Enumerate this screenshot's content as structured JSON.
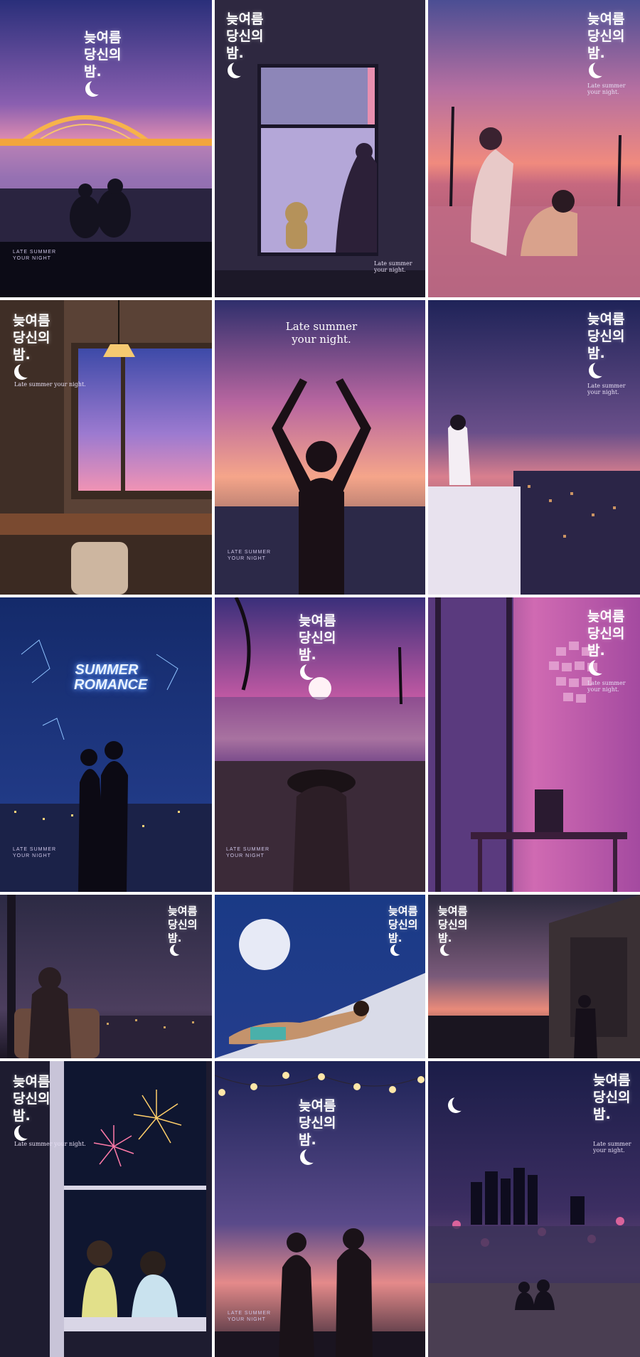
{
  "headline": {
    "line1": "늦여름",
    "line2": "당신의",
    "line3": "밤."
  },
  "subline": "Late summer your night.",
  "caption": {
    "line1": "LATE SUMMER",
    "line2": "YOUR NIGHT"
  },
  "serif_title": {
    "line1": "Late summer",
    "line2": "your night."
  },
  "neon_title": {
    "line1": "SUMMER",
    "line2": "ROMANCE"
  },
  "colors": {
    "night": "#1f2458",
    "dusk_pink": "#e77aa6",
    "violet": "#7c5fb8",
    "gold": "#f2b04a"
  },
  "tiles": [
    {
      "id": 1,
      "scene": "couple watching lit arch bridge over river at dusk"
    },
    {
      "id": 2,
      "scene": "woman sitting at window with teddy bear"
    },
    {
      "id": 3,
      "scene": "couple in infinity pool at sunset with palms"
    },
    {
      "id": 4,
      "scene": "room interior with pendant lamp and window"
    },
    {
      "id": 5,
      "scene": "silhouette with raised arms at sunset sea"
    },
    {
      "id": 6,
      "scene": "woman on rooftop overlooking city at dusk"
    },
    {
      "id": 7,
      "scene": "couple silhouette under constellations over city"
    },
    {
      "id": 8,
      "scene": "woman in sunhat on beach at sunset"
    },
    {
      "id": 9,
      "scene": "pink room with desk and photo wall"
    },
    {
      "id": 10,
      "scene": "woman in chair by window with city view"
    },
    {
      "id": 11,
      "scene": "man lying on deck under full moon"
    },
    {
      "id": 12,
      "scene": "woman leaning out of window at dusk"
    },
    {
      "id": 13,
      "scene": "two children watching fireworks from window"
    },
    {
      "id": 14,
      "scene": "couple toasting wine under string lights"
    },
    {
      "id": 15,
      "scene": "couple sitting on pier facing city skyline"
    }
  ]
}
